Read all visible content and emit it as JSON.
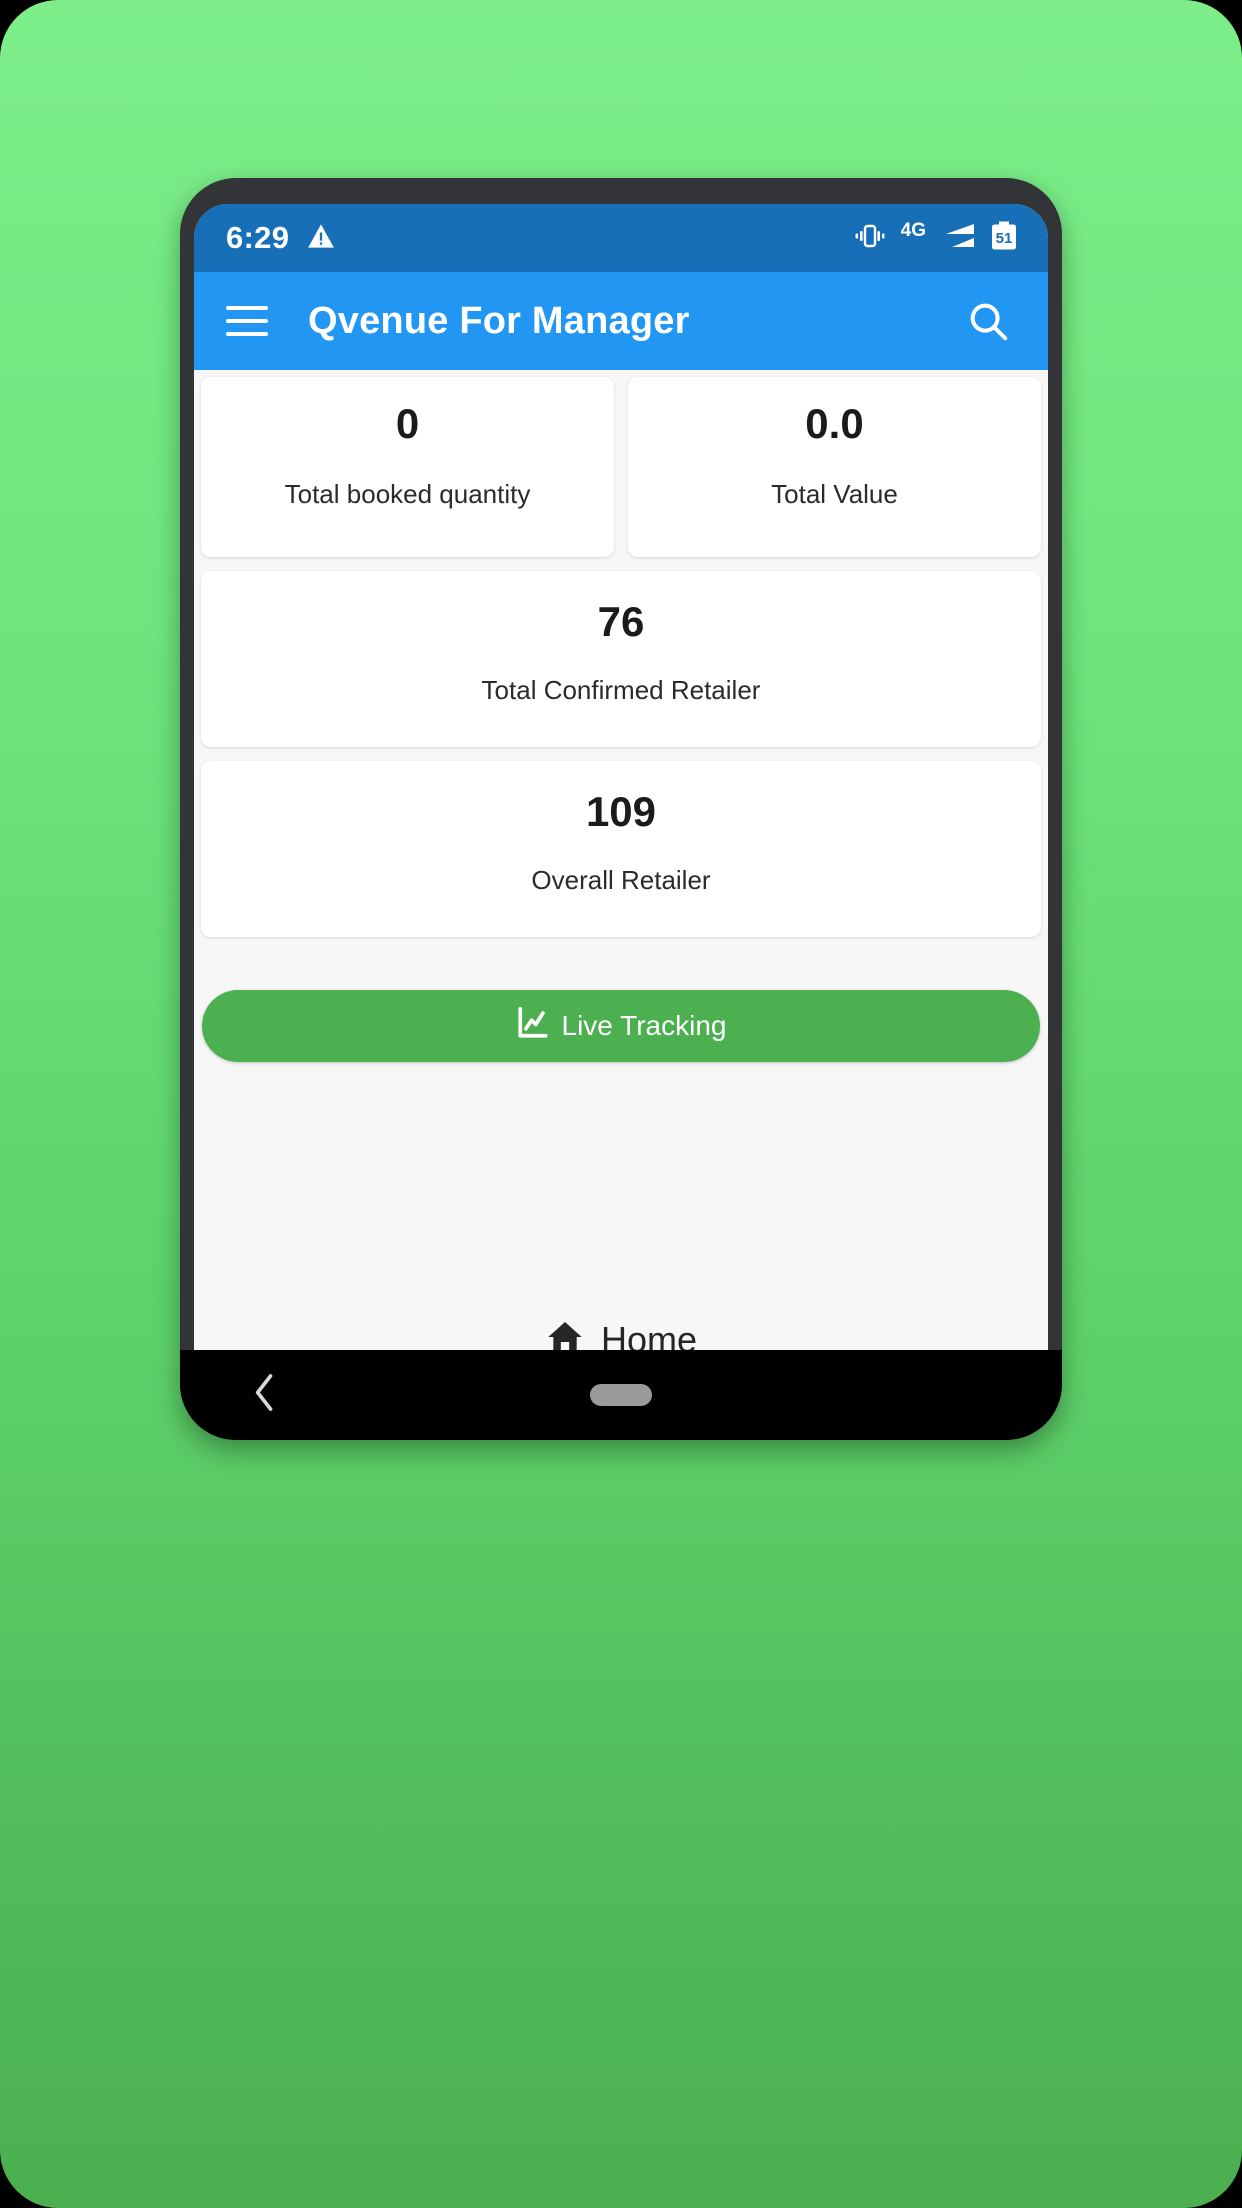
{
  "status_bar": {
    "time": "6:29",
    "warning_icon": "warning-triangle-icon",
    "vibrate_icon": "vibrate-icon",
    "network_label": "4G",
    "signal_icon": "signal-bars-icon",
    "battery_level": "51",
    "background_color": "#176FB8"
  },
  "app_bar": {
    "menu_icon": "hamburger-menu-icon",
    "title": "Qvenue For Manager",
    "search_icon": "search-icon",
    "background_color": "#2196F3"
  },
  "stats": {
    "top_row": [
      {
        "value": "0",
        "label": "Total booked quantity"
      },
      {
        "value": "0.0",
        "label": "Total Value"
      }
    ],
    "confirmed": {
      "value": "76",
      "label": "Total Confirmed Retailer"
    },
    "overall": {
      "value": "109",
      "label": "Overall Retailer"
    }
  },
  "actions": {
    "live_tracking": {
      "label": "Live Tracking",
      "icon": "line-chart-icon",
      "color": "#4CAF50"
    }
  },
  "bottom_nav": {
    "home": {
      "label": "Home",
      "icon": "home-icon"
    }
  },
  "system_nav": {
    "back_icon": "back-chevron-icon",
    "home_pill_icon": "home-pill-icon"
  },
  "theme": {
    "backdrop_top": "#7DEE89",
    "backdrop_bottom": "#4CAF50",
    "card_background": "#FFFFFF",
    "page_background": "#F7F7F7"
  }
}
